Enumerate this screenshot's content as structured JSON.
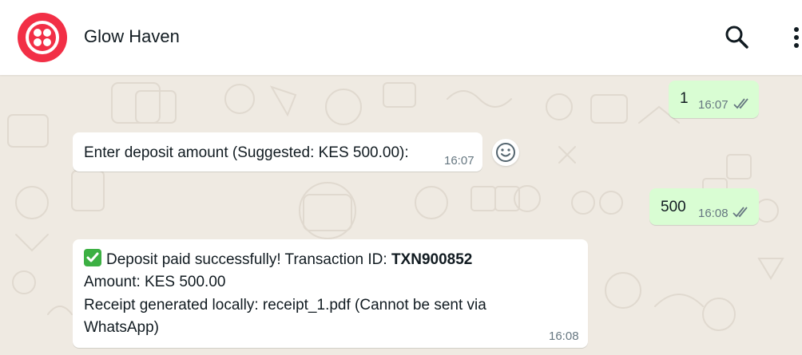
{
  "header": {
    "title": "Glow Haven",
    "icons": {
      "avatar": "twilio-logo",
      "search": "search-icon",
      "menu": "more-vertical-icon"
    }
  },
  "messages": [
    {
      "direction": "out",
      "text": "1",
      "time": "16:07",
      "status": "read"
    },
    {
      "direction": "in",
      "text": "Enter deposit amount (Suggested: KES 500.00):",
      "time": "16:07"
    },
    {
      "direction": "out",
      "text": "500",
      "time": "16:08",
      "status": "read"
    },
    {
      "direction": "in",
      "line1_prefix": "Deposit paid successfully! Transaction ID: ",
      "line1_bold": "TXN900852",
      "line2": "Amount: KES 500.00",
      "line3": "Receipt generated locally: receipt_1.pdf (Cannot be sent via",
      "line4": "WhatsApp)",
      "time": "16:08",
      "emoji": "white-check-mark"
    }
  ],
  "colors": {
    "avatar": "#f22f46",
    "outgoing_bubble": "#d9fdd3",
    "incoming_bubble": "#ffffff",
    "chat_background": "#efeae2",
    "check_emoji": "#3cb043"
  }
}
